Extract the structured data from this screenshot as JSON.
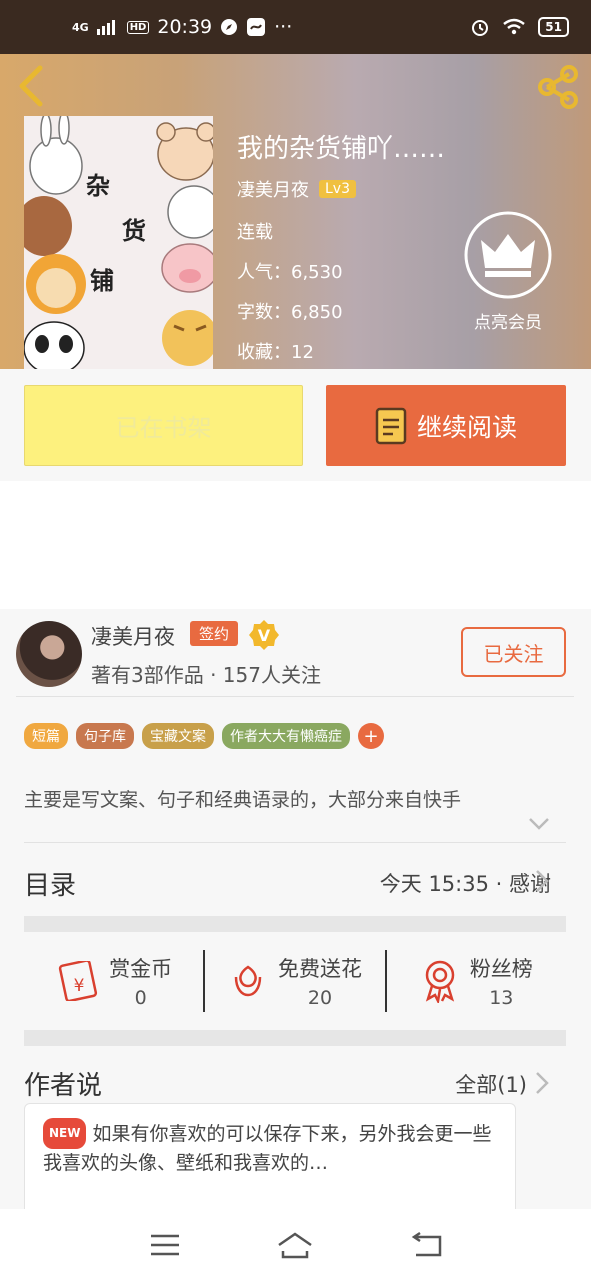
{
  "status_bar": {
    "signal": "4G",
    "hd": "HD",
    "time": "20:39",
    "more": "···",
    "battery": "51"
  },
  "book": {
    "title": "我的杂货铺吖……",
    "author": "凄美月夜",
    "level": "Lv3",
    "status": "连载",
    "popularity": "人气：6,530",
    "word_count": "字数：6,850",
    "favorites": "收藏：12",
    "cover_text": [
      "杂",
      "货",
      "铺"
    ]
  },
  "vip": {
    "label": "点亮会员"
  },
  "actions": {
    "shelf_label": "已在书架",
    "read_label": "继续阅读"
  },
  "author_card": {
    "name": "凄美月夜",
    "sign_badge": "签约",
    "v_badge": "V",
    "meta": "著有3部作品 · 157人关注",
    "follow_label": "已关注",
    "tags": [
      {
        "label": "短篇",
        "color": "#f0a840"
      },
      {
        "label": "句子库",
        "color": "#c8784e"
      },
      {
        "label": "宝藏文案",
        "color": "#c8a04a"
      },
      {
        "label": "作者大大有懒癌症",
        "color": "#8aa860"
      }
    ],
    "tag_more": "+",
    "description": "主要是写文案、句子和经典语录的，大部分来自快手"
  },
  "catalog": {
    "title": "目录",
    "right_text": "今天 15:35 · 感谢"
  },
  "stats": [
    {
      "label": "赏金币",
      "value": "0",
      "icon": "red-envelope-icon"
    },
    {
      "label": "免费送花",
      "value": "20",
      "icon": "flower-icon"
    },
    {
      "label": "粉丝榜",
      "value": "13",
      "icon": "medal-icon"
    }
  ],
  "author_talk": {
    "title": "作者说",
    "right_text": "全部(1)",
    "new_badge": "NEW",
    "content": "如果有你喜欢的可以保存下来，另外我会更一些我喜欢的头像、壁纸和我喜欢的…"
  },
  "colors": {
    "accent": "#e86a40",
    "shelf_yellow": "#fdf17e",
    "level_gold": "#f0c040"
  }
}
